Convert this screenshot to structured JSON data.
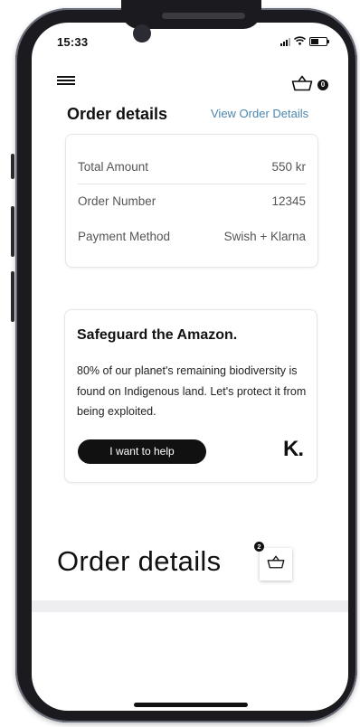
{
  "status_bar": {
    "time": "15:33",
    "icons": [
      "cellular-signal-icon",
      "wifi-icon",
      "battery-icon"
    ]
  },
  "header": {
    "menu_icon": "hamburger-menu-icon",
    "cart_icon": "shopping-basket-icon",
    "cart_badge": "0"
  },
  "order_summary": {
    "title": "Order details",
    "view_link": "View Order Details",
    "rows": [
      {
        "label": "Total Amount",
        "value": "550 kr"
      },
      {
        "label": "Order Number",
        "value": "12345"
      },
      {
        "label": "Payment Method",
        "value": "Swish + Klarna"
      }
    ]
  },
  "promo_card": {
    "title": "Safeguard the Amazon.",
    "body": "80% of our planet's remaining biodiversity is found on Indigenous land. Let's protect it from being exploited.",
    "button_label": "I want to help",
    "logo_text": "K."
  },
  "order_widget": {
    "title": "Order details",
    "badge": "2",
    "cart_icon": "shopping-basket-icon"
  },
  "colors": {
    "link": "#4a86b0",
    "button_bg": "#111111",
    "frame": "#1b1b1f"
  }
}
